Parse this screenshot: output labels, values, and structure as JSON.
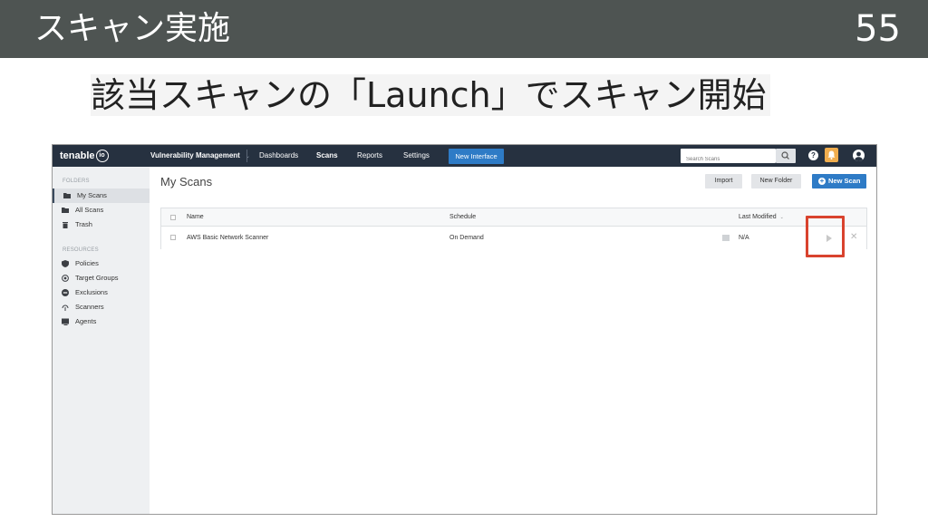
{
  "slide": {
    "title": "スキャン実施",
    "number": "55",
    "subtitle": "該当スキャンの「Launch」でスキャン開始",
    "highlight_color": "#d9432e"
  },
  "app": {
    "logo_text": "tenable",
    "logo_badge": "io",
    "nav": {
      "product": "Vulnerability Management",
      "product_caret": "⌄",
      "items": [
        "Dashboards",
        "Scans",
        "Reports",
        "Settings"
      ],
      "active": "Scans",
      "new_interface": "New Interface"
    },
    "search": {
      "placeholder": "Search Scans"
    },
    "help_icon": "?",
    "icons": {
      "search": "search-icon",
      "notifications": "bell-icon",
      "user": "user-icon"
    },
    "colors": {
      "topbar": "#263140",
      "accent": "#2e7bc6",
      "notification": "#f0ad4e"
    },
    "sidebar": {
      "folders_heading": "FOLDERS",
      "folders": [
        {
          "label": "My Scans",
          "icon": "folder-open-icon",
          "active": true
        },
        {
          "label": "All Scans",
          "icon": "folder-icon",
          "active": false
        },
        {
          "label": "Trash",
          "icon": "trash-icon",
          "active": false
        }
      ],
      "resources_heading": "RESOURCES",
      "resources": [
        {
          "label": "Policies",
          "icon": "shield-icon"
        },
        {
          "label": "Target Groups",
          "icon": "target-icon"
        },
        {
          "label": "Exclusions",
          "icon": "minus-circle-icon"
        },
        {
          "label": "Scanners",
          "icon": "scanner-icon"
        },
        {
          "label": "Agents",
          "icon": "agent-icon"
        }
      ]
    },
    "main": {
      "title": "My Scans",
      "import_label": "Import",
      "new_folder_label": "New Folder",
      "new_scan_label": "New Scan",
      "table": {
        "columns": [
          "Name",
          "Schedule",
          "Last Modified"
        ],
        "sort_indicator": "⌄",
        "rows": [
          {
            "name": "AWS Basic Network Scanner",
            "schedule": "On Demand",
            "last_modified": "N/A"
          }
        ]
      }
    }
  }
}
